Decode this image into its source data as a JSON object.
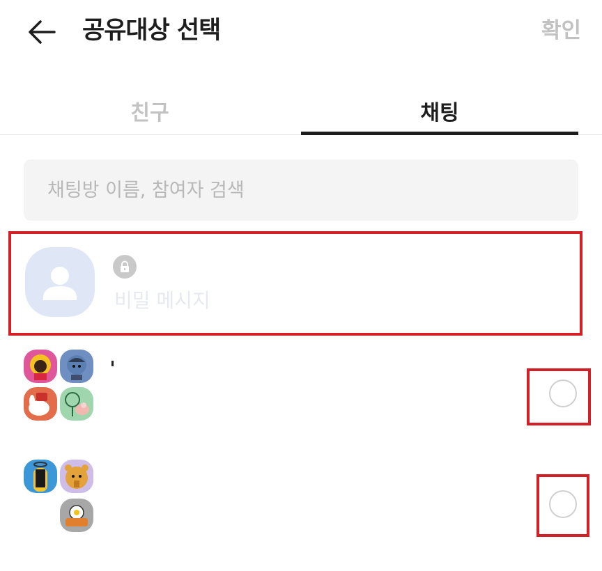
{
  "header": {
    "title": "공유대상 선택",
    "confirm_label": "확인"
  },
  "tabs": [
    {
      "label": "친구",
      "active": false
    },
    {
      "label": "채팅",
      "active": true
    }
  ],
  "search": {
    "placeholder": "채팅방 이름, 참여자 검색",
    "value": ""
  },
  "secret_chat": {
    "label": "비밀 메시지",
    "icons": [
      "person-avatar-icon",
      "lock-icon"
    ]
  },
  "chat_rooms": [
    {
      "title": "",
      "selected": false,
      "avatar_colors": [
        "#e0569b",
        "#6f8fc2",
        "#e36c4a",
        "#9fd6ae"
      ],
      "icons": [
        "group-avatar-icon",
        "radio-unchecked-icon"
      ]
    },
    {
      "title": "",
      "selected": false,
      "avatar_colors": [
        "#3c97d8",
        "#cdbde8",
        "#ffffff",
        "#a7a7a7"
      ],
      "icons": [
        "group-avatar-icon",
        "radio-unchecked-icon"
      ]
    }
  ],
  "colors": {
    "accent_dark": "#1d1d1d",
    "muted": "#c2c2c2",
    "highlight_border": "#d32027",
    "search_bg": "#f4f4f4"
  }
}
